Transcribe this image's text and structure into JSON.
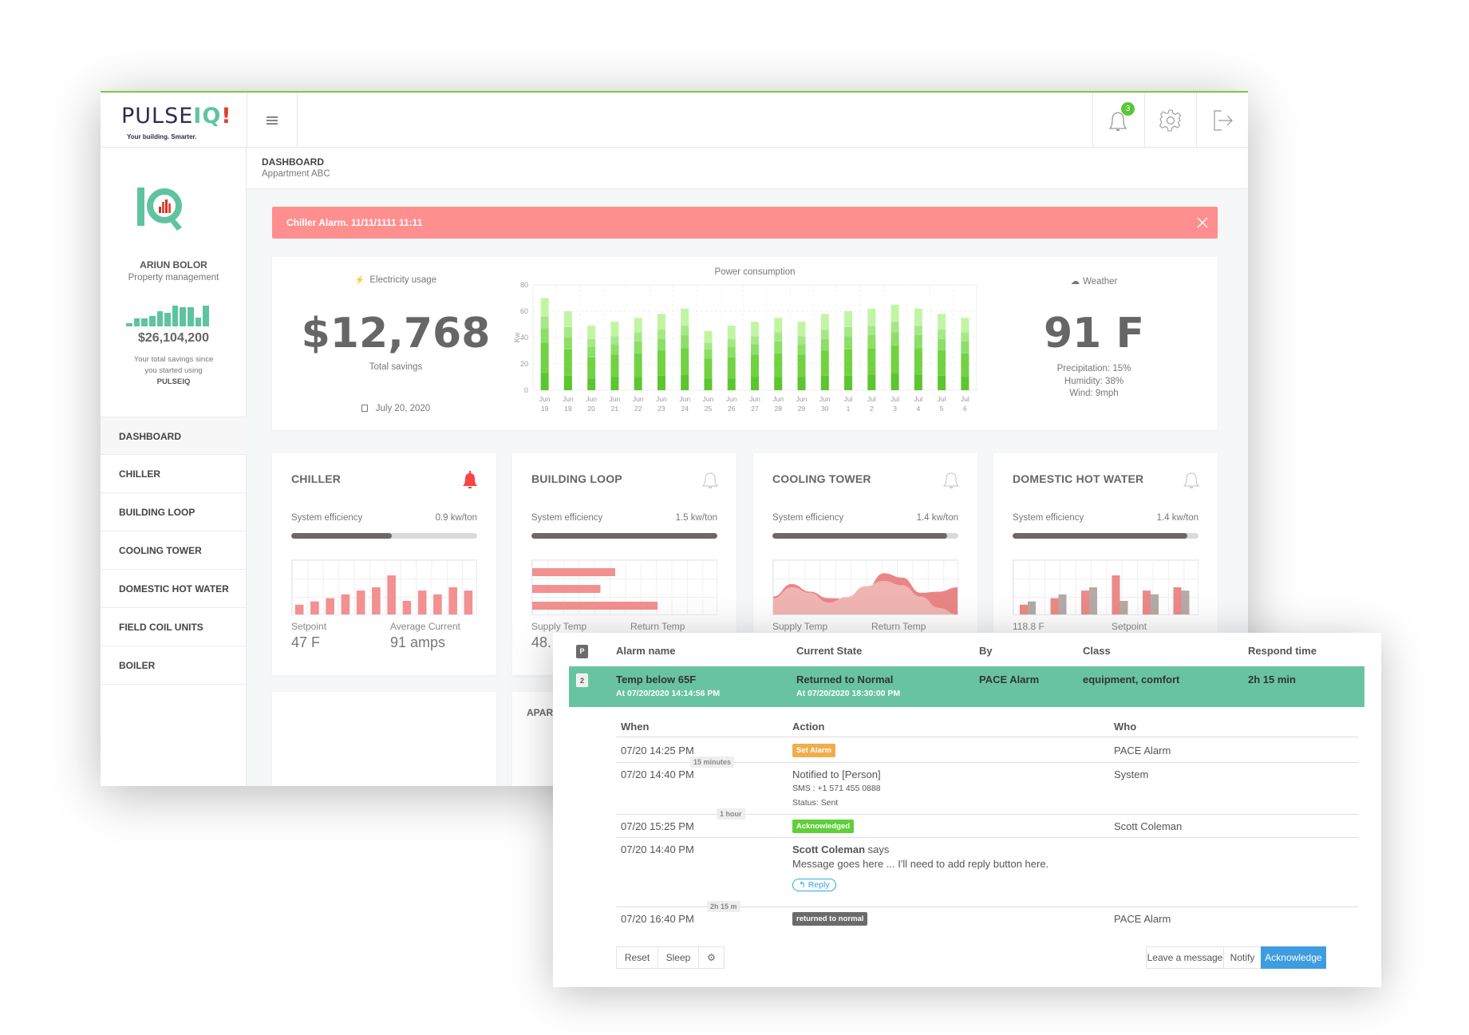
{
  "header": {
    "logo_text": "PULSEIQ!",
    "logo_tagline": "Your building. Smarter.",
    "notification_count": "3",
    "icons": [
      "hamburger-menu-icon",
      "bell-icon",
      "gear-icon",
      "logout-icon"
    ]
  },
  "sidebar": {
    "user_name": "ARIUN BOLOR",
    "user_role": "Property management",
    "savings_spark": [
      15,
      39,
      37,
      51,
      75,
      66,
      100,
      92,
      92,
      42,
      100
    ],
    "total_savings": "$26,104,200",
    "savings_caption_1": "Your total savings since",
    "savings_caption_2": "you started using",
    "savings_caption_brand": "PULSEIQ",
    "items": [
      {
        "label": "DASHBOARD",
        "active": true
      },
      {
        "label": "CHILLER"
      },
      {
        "label": "BUILDING LOOP"
      },
      {
        "label": "COOLING TOWER"
      },
      {
        "label": "DOMESTIC HOT WATER"
      },
      {
        "label": "FIELD COIL UNITS"
      },
      {
        "label": "BOILER"
      }
    ]
  },
  "breadcrumb": {
    "title": "DASHBOARD",
    "subtitle": "Appartment ABC"
  },
  "alert": {
    "text": "Chiller Alarm. 11/11/1111 11:11",
    "color": "#ff8f8f"
  },
  "summary": {
    "electricity_label": "Electricity usage",
    "savings_value": "$12,768",
    "savings_label": "Total savings",
    "date": "July 20, 2020",
    "weather_label": "Weather",
    "temperature": "91 F",
    "precipitation": "Precipitation: 15%",
    "humidity": "Humidity: 38%",
    "wind": "Wind: 9mph"
  },
  "chart_data": [
    {
      "type": "bar",
      "stacked": true,
      "title": "Power consumption",
      "ylabel": "Kw",
      "ylim": [
        0,
        80
      ],
      "yticks": [
        "0",
        "20",
        "40",
        "60",
        "80"
      ],
      "grid": true,
      "categories": [
        "Jun 19",
        "Jun 19",
        "Jun 20",
        "Jun 21",
        "Jun 22",
        "Jun 23",
        "Jun 24",
        "Jun 25",
        "Jun 26",
        "Jun 27",
        "Jun 28",
        "Jun 29",
        "Jun 30",
        "Jul 1",
        "Jul 2",
        "Jul 3",
        "Jul 4",
        "Jul 5",
        "Jul 6"
      ],
      "segment_colors": [
        "#5cc52f",
        "#72d243",
        "#8ddf67",
        "#a6e888",
        "#c2f5a3"
      ],
      "stacks": [
        [
          13,
          23,
          11,
          9,
          14
        ],
        [
          11,
          20,
          9,
          8,
          12
        ],
        [
          9,
          16,
          8,
          6,
          10
        ],
        [
          10,
          17,
          8,
          6,
          11
        ],
        [
          10,
          18,
          9,
          7,
          11
        ],
        [
          11,
          19,
          9,
          7,
          12
        ],
        [
          12,
          20,
          10,
          7,
          13
        ],
        [
          9,
          15,
          7,
          5,
          9
        ],
        [
          9,
          16,
          8,
          6,
          10
        ],
        [
          10,
          17,
          8,
          6,
          11
        ],
        [
          10,
          18,
          9,
          7,
          11
        ],
        [
          10,
          17,
          8,
          6,
          11
        ],
        [
          11,
          19,
          9,
          7,
          12
        ],
        [
          11,
          20,
          10,
          7,
          12
        ],
        [
          12,
          20,
          10,
          7,
          13
        ],
        [
          13,
          21,
          10,
          8,
          13
        ],
        [
          12,
          20,
          10,
          7,
          13
        ],
        [
          11,
          19,
          9,
          7,
          12
        ],
        [
          10,
          18,
          9,
          7,
          11
        ]
      ]
    },
    {
      "type": "bar",
      "card": "chiller",
      "values": [
        18,
        24,
        30,
        37,
        44,
        50,
        72,
        25,
        44,
        37,
        50,
        44
      ],
      "color": "#f39090"
    },
    {
      "type": "bar",
      "orientation": "horizontal",
      "card": "building-loop",
      "values": [
        45,
        37,
        68
      ],
      "color": "#f39090"
    },
    {
      "type": "area",
      "card": "cooling-tower",
      "series": [
        {
          "values": [
            33,
            56,
            42,
            30,
            29,
            46,
            76,
            68,
            40,
            42,
            50
          ],
          "color": "#ea8585"
        },
        {
          "values": [
            30,
            50,
            40,
            22,
            32,
            52,
            62,
            54,
            33,
            12,
            0
          ],
          "color": "#f0b5b3"
        }
      ]
    },
    {
      "type": "bar",
      "card": "domestic-hot-water",
      "series": [
        {
          "values": [
            18,
            30,
            44,
            72,
            44,
            50
          ],
          "color": "#eb8a88"
        },
        {
          "values": [
            24,
            37,
            50,
            25,
            37,
            44
          ],
          "color": "#b5aaa8"
        }
      ]
    }
  ],
  "cards": [
    {
      "title": "CHILLER",
      "alarm": true,
      "eff_label": "System efficiency",
      "eff_value": "0.9 kw/ton",
      "eff_fill": 0.54,
      "label1": "Setpoint",
      "label2": "Average Current",
      "value1": "47 F",
      "value2": "91 amps"
    },
    {
      "title": "BUILDING LOOP",
      "alarm": false,
      "eff_label": "System efficiency",
      "eff_value": "1.5 kw/ton",
      "eff_fill": 1.0,
      "label1": "Supply Temp",
      "label2": "Return Temp",
      "value1": "48."
    },
    {
      "title": "COOLING TOWER",
      "alarm": false,
      "eff_label": "System efficiency",
      "eff_value": "1.4 kw/ton",
      "eff_fill": 0.94,
      "label1": "Supply Temp",
      "label2": "Return Temp"
    },
    {
      "title": "DOMESTIC HOT WATER",
      "alarm": false,
      "eff_label": "System efficiency",
      "eff_value": "1.4 kw/ton",
      "eff_fill": 0.94,
      "label1": "118.8 F",
      "label2": "Setpoint"
    }
  ],
  "bottom_cards": [
    {
      "title": ""
    },
    {
      "title": "APAR"
    }
  ],
  "alarm_popup": {
    "header_badge": "P",
    "columns": [
      "Alarm name",
      "Current State",
      "By",
      "Class",
      "Respond time"
    ],
    "row": {
      "badge": "2",
      "name": "Temp below 65F",
      "name_time": "At 07/20/2020 14:14:56 PM",
      "state": "Returned to Normal",
      "state_time": "At 07/20/2020 18:30:00 PM",
      "by": "PACE Alarm",
      "class": "equipment, comfort",
      "respond": "2h 15 min",
      "color": "#68c4a0"
    },
    "detail_columns": [
      "When",
      "Action",
      "Who"
    ],
    "events": [
      {
        "when": "07/20 14:25 PM",
        "tag": "Set Alarm",
        "tag_color": "#f0ad4e",
        "who": "PACE Alarm"
      },
      {
        "gap": "15 minutes",
        "when": "07/20 14:40 PM",
        "action": "Notified to [Person]",
        "sms": "SMS : +1 571 455 0888",
        "status": "Status: Sent",
        "who": "System"
      },
      {
        "gap": "1 hour",
        "when": "07/20 15:25 PM",
        "tag": "Acknowledged",
        "tag_color": "#5fcf3a",
        "who": "Scott Coleman"
      },
      {
        "when": "07/20 14:40 PM",
        "author": "Scott Coleman",
        "says": "says",
        "message": "Message goes here ... I'll need to add reply button here.",
        "reply": "Reply"
      },
      {
        "gap": "2h 15 m",
        "when": "07/20 16:40 PM",
        "tag": "returned to normal",
        "tag_color": "#6b6b6b",
        "who": "PACE Alarm"
      }
    ],
    "buttons": {
      "reset": "Reset",
      "sleep": "Sleep",
      "leave": "Leave a message",
      "notify": "Notify",
      "acknowledge": "Acknowledge",
      "acknowledge_color": "#3d9de0"
    }
  }
}
